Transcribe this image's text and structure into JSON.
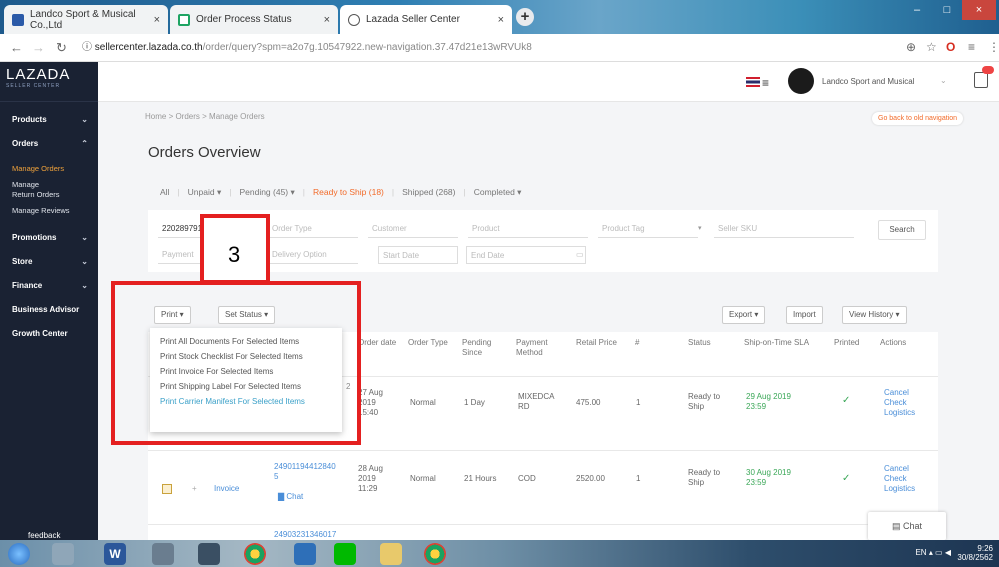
{
  "browser": {
    "tabs": [
      {
        "title": "Landco Sport & Musical Co.,Ltd"
      },
      {
        "title": "Order Process Status"
      },
      {
        "title": "Lazada Seller Center"
      }
    ],
    "url_host": "sellercenter.lazada.co.th",
    "url_path": "/order/query?spm=a2o7g.10547922.new-navigation.37.47d21e13wRVUk8"
  },
  "sidebar": {
    "logo": "LAZADA",
    "logo_sub": "SELLER CENTER",
    "items": [
      {
        "label": "Products"
      },
      {
        "label": "Orders"
      },
      {
        "label": "Promotions"
      },
      {
        "label": "Store"
      },
      {
        "label": "Finance"
      },
      {
        "label": "Business Advisor"
      },
      {
        "label": "Growth Center"
      }
    ],
    "orders_sub": [
      "Manage Orders",
      "Manage Return Orders",
      "Manage Reviews"
    ],
    "feedback": "feedback"
  },
  "topbar": {
    "store_name": "Landco Sport and Musical"
  },
  "main": {
    "breadcrumb": "Home  >  Orders  >  Manage Orders",
    "back_nav": "Go back to old navigation",
    "title": "Orders Overview",
    "tabs": [
      {
        "label": "All"
      },
      {
        "label": "Unpaid ▾"
      },
      {
        "label": "Pending (45) ▾"
      },
      {
        "label": "Ready to Ship (18)"
      },
      {
        "label": "Shipped (268)"
      },
      {
        "label": "Completed ▾"
      }
    ],
    "filters": {
      "order_no": "2202897",
      "order_no_suffix": "9124289",
      "order_type": "Order Type",
      "customer": "Customer",
      "product": "Product",
      "product_tag": "Product Tag",
      "seller_sku": "Seller SKU",
      "search": "Search",
      "payment": "Payment",
      "delivery": "Delivery Option",
      "start_date": "Start Date",
      "end_date": "End Date"
    },
    "actions": {
      "print": "Print ▾",
      "set_status": "Set Status ▾",
      "export": "Export ▾",
      "import": "Import",
      "view_history": "View History ▾"
    },
    "print_menu": [
      "Print All Documents For Selected Items",
      "Print Stock Checklist For Selected Items",
      "Print Invoice For Selected Items",
      "Print Shipping Label For Selected Items",
      "Print Carrier Manifest For Selected Items"
    ],
    "columns": [
      "Order date",
      "Order Type",
      "Pending Since",
      "Payment Method",
      "Retail Price",
      "#",
      "Status",
      "Ship-on-Time SLA",
      "Printed",
      "Actions"
    ],
    "rows": [
      {
        "order_date": [
          "27 Aug",
          "2019",
          "15:40"
        ],
        "order_type": "Normal",
        "pending": "1 Day",
        "payment": [
          "MIXEDCA",
          "RD"
        ],
        "price": "475.00",
        "qty": "1",
        "status": [
          "Ready to",
          "Ship"
        ],
        "sla": [
          "29 Aug 2019",
          "23:59"
        ],
        "actions": [
          "Cancel",
          "Check",
          "Logistics"
        ]
      },
      {
        "invoice": "Invoice",
        "order_no": [
          "24901194412840",
          "5"
        ],
        "chat": "Chat",
        "order_date": [
          "28 Aug",
          "2019",
          "11:29"
        ],
        "order_type": "Normal",
        "pending": "21 Hours",
        "payment": [
          "COD"
        ],
        "price": "2520.00",
        "qty": "1",
        "status": [
          "Ready to",
          "Ship"
        ],
        "sla": [
          "30 Aug 2019",
          "23:59"
        ],
        "actions": [
          "Cancel",
          "Check",
          "Logistics"
        ]
      }
    ],
    "row3_order": "24903231346017",
    "menu_badge": "2"
  },
  "callout": {
    "number": "3"
  },
  "chat_widget": "Chat",
  "taskbar": {
    "lang": "EN",
    "time": "9:26",
    "date": "30/8/2562"
  }
}
